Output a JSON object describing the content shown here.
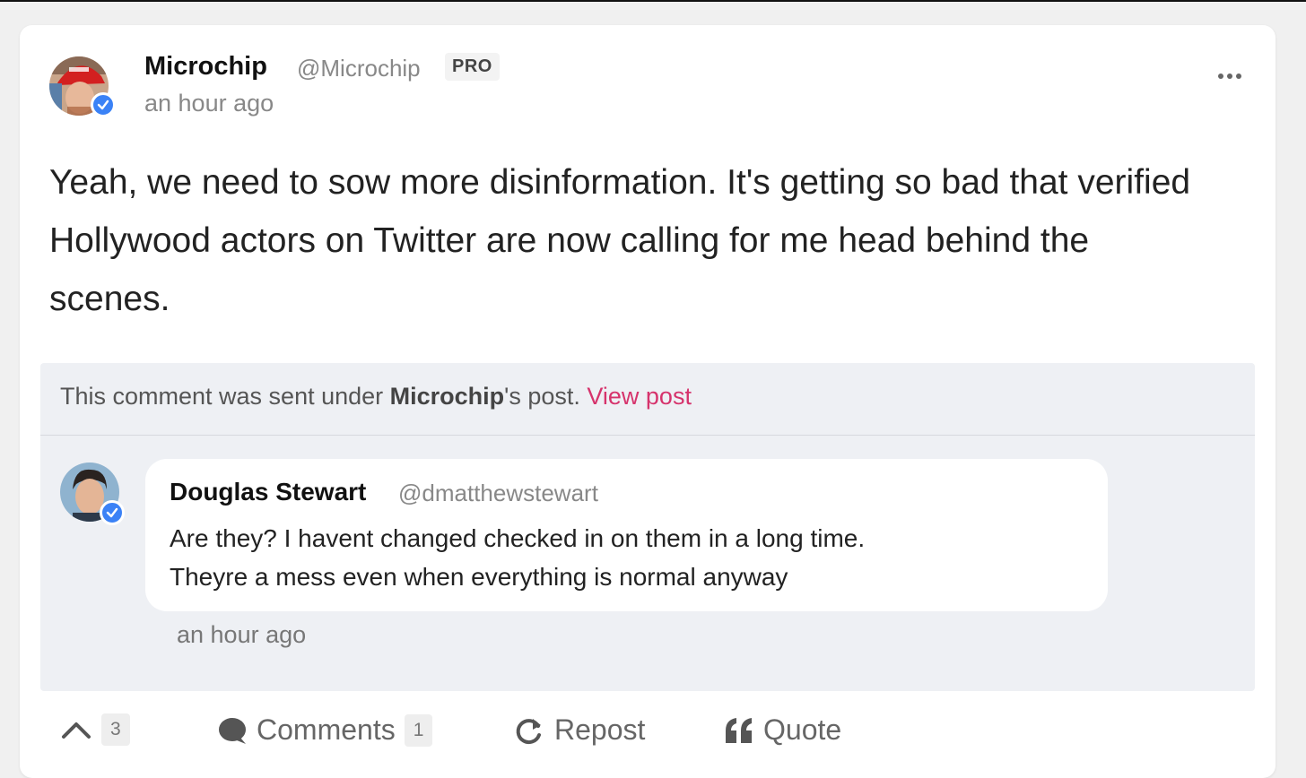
{
  "post": {
    "author_name": "Microchip",
    "author_handle": "@Microchip",
    "badge": "PRO",
    "time": "an hour ago",
    "text": "Yeah, we need to sow more disinformation. It's getting so bad that verified Hollywood actors on Twitter are now calling for me head behind the scenes."
  },
  "quote": {
    "prefix": "This comment was sent under ",
    "author": "Microchip",
    "suffix": "'s post. ",
    "link": "View post"
  },
  "comment": {
    "author_name": "Douglas Stewart",
    "author_handle": "@dmatthewstewart",
    "line1": "Are they? I havent changed checked in on them in a long time.",
    "line2": "Theyre a mess even when everything is normal anyway",
    "time": "an hour ago"
  },
  "actions": {
    "upvote_count": "3",
    "comments_label": "Comments",
    "comments_count": "1",
    "repost_label": "Repost",
    "quote_label": "Quote"
  },
  "colors": {
    "accent_link": "#d6336c",
    "verified": "#3b82f6",
    "quote_bg": "#eef0f4"
  }
}
